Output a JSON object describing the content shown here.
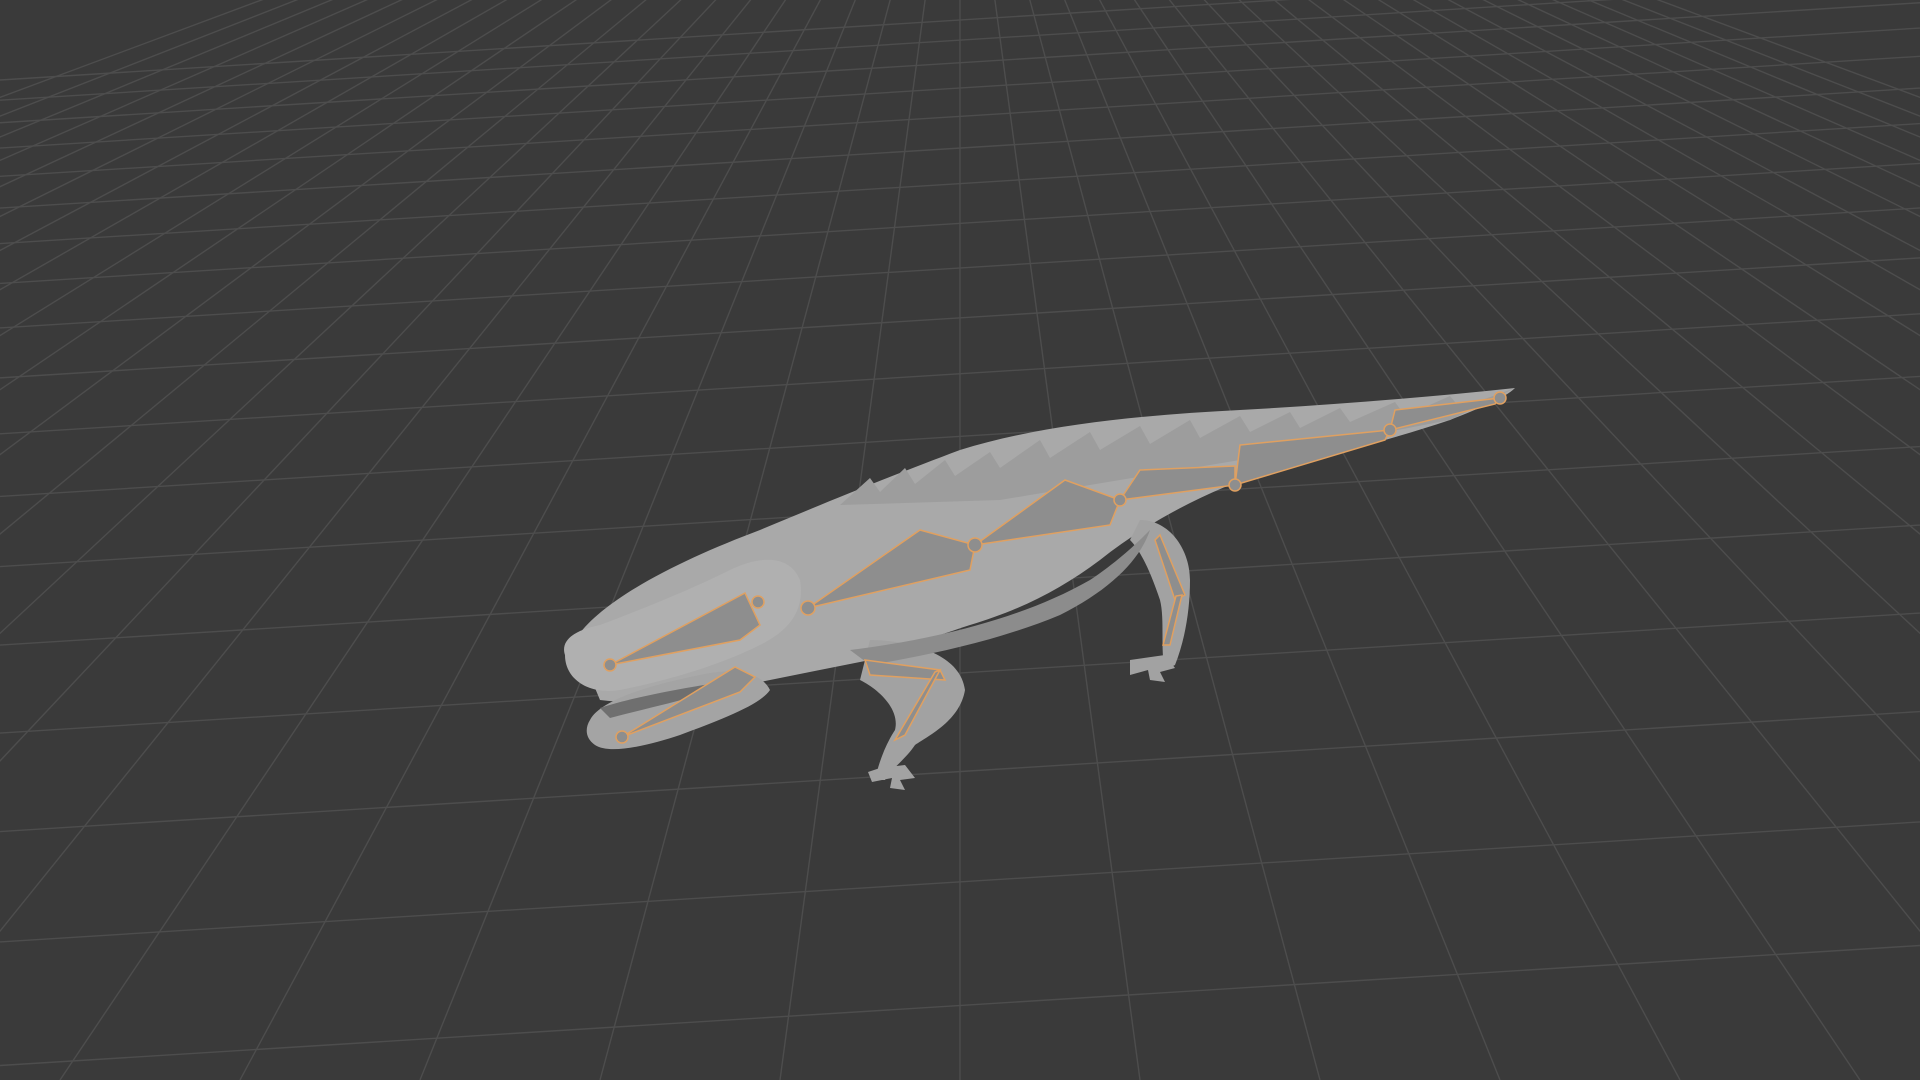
{
  "viewport": {
    "name": "3D Viewport",
    "background": "#3a3a3a",
    "grid_color": "#4d4d4d",
    "mesh_color": "#a9a9a9",
    "mesh_shadow_color": "#8c8c8c",
    "bone_fill_color": "#8e8e8e",
    "bone_outline_color": "#e0a060"
  },
  "scene": {
    "object": "crocodile-mesh",
    "armature": "crocodile-armature",
    "mode": "armature-selected",
    "icons": [
      "crocodile-mesh-icon",
      "armature-bone-icon"
    ]
  }
}
